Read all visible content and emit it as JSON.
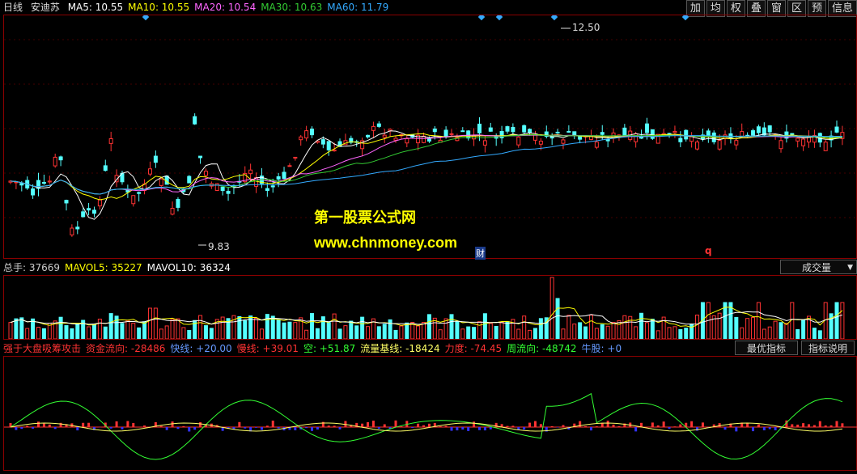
{
  "header": {
    "period": "日线",
    "stock": "安迪苏",
    "ma": [
      {
        "label": "MA5: 10.55",
        "color": "#ffffff"
      },
      {
        "label": "MA10: 10.55",
        "color": "#ffff00"
      },
      {
        "label": "MA20: 10.54",
        "color": "#ff66ff"
      },
      {
        "label": "MA30: 10.63",
        "color": "#33cc33"
      },
      {
        "label": "MA60: 11.79",
        "color": "#33aaff"
      }
    ]
  },
  "toolbar": [
    "加",
    "均",
    "权",
    "叠",
    "窗",
    "区",
    "预",
    "信息"
  ],
  "price": {
    "high_label": "12.50",
    "low_label": "9.83",
    "fin_mark": "财",
    "q_mark": "q"
  },
  "watermark": {
    "cn": "第一股票公式网",
    "url": "www.chnmoney.com"
  },
  "volume": {
    "items": [
      {
        "label": "总手: 37669",
        "color": "#cccccc"
      },
      {
        "label": "MAVOL5: 35227",
        "color": "#ffff00"
      },
      {
        "label": "MAVOL10: 36324",
        "color": "#ffffff"
      }
    ],
    "selector": "成交量"
  },
  "indicator": {
    "items": [
      {
        "label": "强于大盘吸筹攻击",
        "color": "#ff3333"
      },
      {
        "label": "资金流向: -28486",
        "color": "#ff3333"
      },
      {
        "label": "快线: +20.00",
        "color": "#6699ff"
      },
      {
        "label": "慢线: +39.01",
        "color": "#ff3333"
      },
      {
        "label": "空: +51.87",
        "color": "#33ff33"
      },
      {
        "label": "流量基线: -18424",
        "color": "#ffff66"
      },
      {
        "label": "力度: -74.45",
        "color": "#ff3333"
      },
      {
        "label": "周流向: -48742",
        "color": "#33ff33"
      },
      {
        "label": "牛股: +0",
        "color": "#6699ff"
      }
    ],
    "best_button": "最优指标",
    "help_button": "指标说明"
  },
  "colors": {
    "up": "#ff3333",
    "down": "#54ffff",
    "border": "#8b0000"
  }
}
